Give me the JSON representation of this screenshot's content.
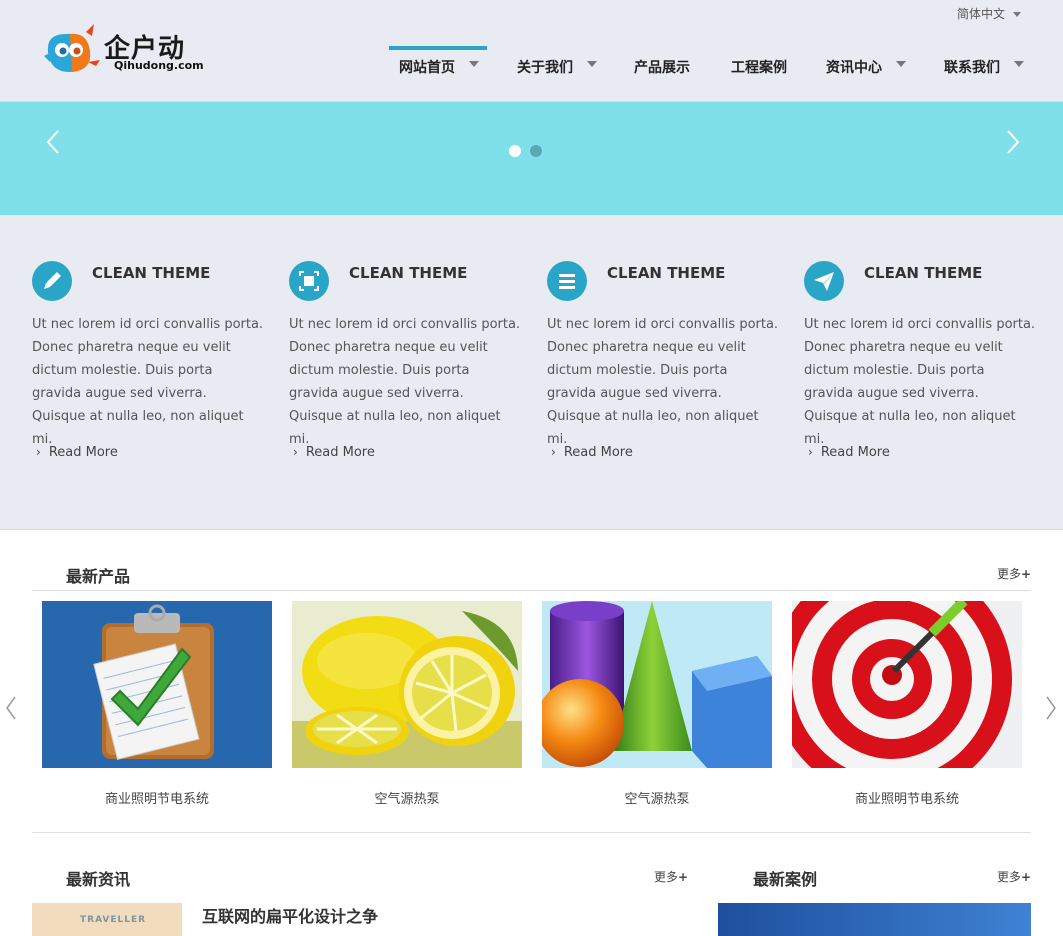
{
  "header": {
    "language": "简体中文",
    "logo": {
      "name": "企户动",
      "subtitle": "Qihudong.com"
    },
    "nav": [
      {
        "label": "网站首页",
        "active": true,
        "dropdown": true
      },
      {
        "label": "关于我们",
        "active": false,
        "dropdown": true
      },
      {
        "label": "产品展示",
        "active": false,
        "dropdown": false
      },
      {
        "label": "工程案例",
        "active": false,
        "dropdown": false
      },
      {
        "label": "资讯中心",
        "active": false,
        "dropdown": true
      },
      {
        "label": "联系我们",
        "active": false,
        "dropdown": true
      }
    ]
  },
  "banner": {
    "slides": 2,
    "active_slide": 1,
    "color": "#80e0ea"
  },
  "features": [
    {
      "icon": "pencil-icon",
      "title": "CLEAN THEME",
      "text": "Ut nec lorem id orci convallis porta. Donec pharetra neque eu velit dictum molestie. Duis porta gravida augue sed viverra. Quisque at nulla leo, non aliquet mi.",
      "more": "Read More"
    },
    {
      "icon": "screen-frame-icon",
      "title": "CLEAN THEME",
      "text": "Ut nec lorem id orci convallis porta. Donec pharetra neque eu velit dictum molestie. Duis porta gravida augue sed viverra. Quisque at nulla leo, non aliquet mi.",
      "more": "Read More"
    },
    {
      "icon": "list-icon",
      "title": "CLEAN THEME",
      "text": "Ut nec lorem id orci convallis porta. Donec pharetra neque eu velit dictum molestie. Duis porta gravida augue sed viverra. Quisque at nulla leo, non aliquet mi.",
      "more": "Read More"
    },
    {
      "icon": "paper-plane-icon",
      "title": "CLEAN THEME",
      "text": "Ut nec lorem id orci convallis porta. Donec pharetra neque eu velit dictum molestie. Duis porta gravida augue sed viverra. Quisque at nulla leo, non aliquet mi.",
      "more": "Read More"
    }
  ],
  "products": {
    "title": "最新产品",
    "more": "更多",
    "items": [
      {
        "caption": "商业照明节电系统",
        "image": "clipboard-checkmark"
      },
      {
        "caption": "空气源热泵",
        "image": "lemons"
      },
      {
        "caption": "空气源热泵",
        "image": "geometric-shapes"
      },
      {
        "caption": "商业照明节电系统",
        "image": "target-dart"
      }
    ]
  },
  "news": {
    "title": "最新资讯",
    "more": "更多",
    "thumb_text": "TRAVELLER",
    "headline": "互联网的扁平化设计之争"
  },
  "cases": {
    "title": "最新案例",
    "more": "更多"
  },
  "colors": {
    "accent": "#29a6c7",
    "header_bg": "#e9ebf3",
    "banner": "#80e0ea"
  }
}
